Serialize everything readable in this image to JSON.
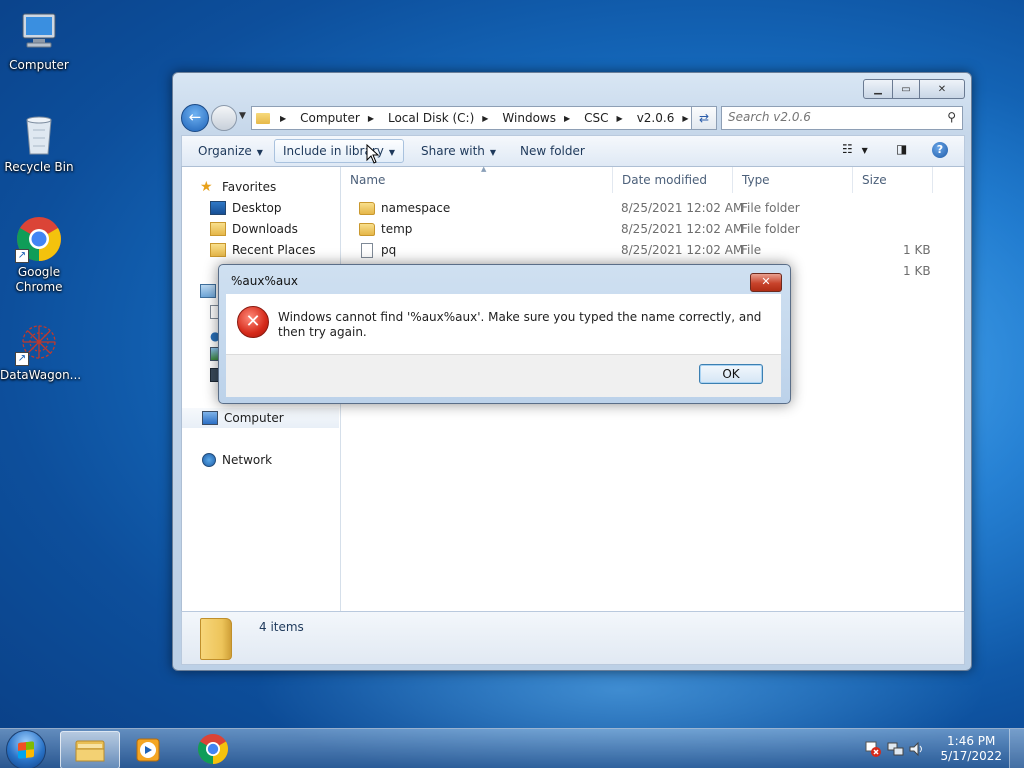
{
  "desktop": {
    "icons": [
      {
        "label": "Computer"
      },
      {
        "label": "Recycle Bin"
      },
      {
        "label": "Google Chrome"
      },
      {
        "label": "DataWagon..."
      }
    ]
  },
  "explorer": {
    "breadcrumb": [
      "Computer",
      "Local Disk (C:)",
      "Windows",
      "CSC",
      "v2.0.6"
    ],
    "search_placeholder": "Search v2.0.6",
    "toolbar": {
      "organize": "Organize",
      "include_in_library": "Include in library",
      "share_with": "Share with",
      "new_folder": "New folder"
    },
    "nav": {
      "favorites": "Favorites",
      "desktop": "Desktop",
      "downloads": "Downloads",
      "recent_places": "Recent Places",
      "computer": "Computer",
      "network": "Network"
    },
    "columns": {
      "name": "Name",
      "date_modified": "Date modified",
      "type": "Type",
      "size": "Size"
    },
    "files": [
      {
        "name": "namespace",
        "date": "8/25/2021 12:02 AM",
        "type": "File folder",
        "size": ""
      },
      {
        "name": "temp",
        "date": "8/25/2021 12:02 AM",
        "type": "File folder",
        "size": ""
      },
      {
        "name": "pq",
        "date": "8/25/2021 12:02 AM",
        "type": "File",
        "size": "1 KB"
      },
      {
        "name": "",
        "date": "",
        "type": "",
        "size": "1 KB"
      }
    ],
    "status": "4 items"
  },
  "dialog": {
    "title": "%aux%aux",
    "message": "Windows cannot find '%aux%aux'. Make sure you typed the name correctly, and then try again.",
    "ok_label": "OK"
  },
  "taskbar": {
    "time": "1:46 PM",
    "date": "5/17/2022"
  },
  "colors": {
    "accent": "#1f63b8",
    "error": "#d52a1a"
  }
}
